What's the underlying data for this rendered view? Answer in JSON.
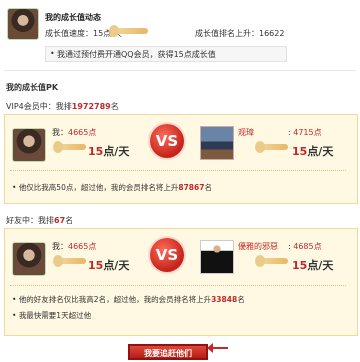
{
  "header": {
    "title": "我的成长值动态",
    "speed_label": "成长值速度：15点/天",
    "rank_label": "成长值排名上升：16622",
    "tip": "我通过预付费开通QQ会员，获得15点成长值"
  },
  "pk": {
    "title": "我的成长值PK",
    "vip_line_prefix": "VIP4会员中：我排",
    "vip_rank": "1972789",
    "vip_line_suffix": "名",
    "card1": {
      "me_label": "我：",
      "me_points": "4665点",
      "me_rate_num": "15",
      "me_rate_unit": "点/天",
      "vs": "VS",
      "other_name": "观璋",
      "other_points": "4715点",
      "other_rate_num": "15",
      "other_rate_unit": "点/天",
      "note_prefix": "他仅比我高50点，超过他，我的会员排名将上升",
      "note_rank": "87867",
      "note_suffix": "名"
    },
    "friend_line_prefix": "好友中：我排",
    "friend_rank": "67",
    "friend_line_suffix": "名",
    "card2": {
      "me_label": "我：",
      "me_points": "4665点",
      "me_rate_num": "15",
      "me_rate_unit": "点/天",
      "vs": "VS",
      "other_name": "優雅的邪惡",
      "other_points": "4685点",
      "other_rate_num": "15",
      "other_rate_unit": "点/天",
      "note1_prefix": "他的好友排名仅比我高2名，超过他，我的会员排名将上升",
      "note1_rank": "33848",
      "note1_suffix": "名",
      "note2": "我最快需要1天超过他"
    },
    "cta_label": "我要追赶他们"
  },
  "colors": {
    "accent": "#c0292a",
    "panel_bg": "#fff8e3",
    "panel_border": "#f0d99a"
  }
}
